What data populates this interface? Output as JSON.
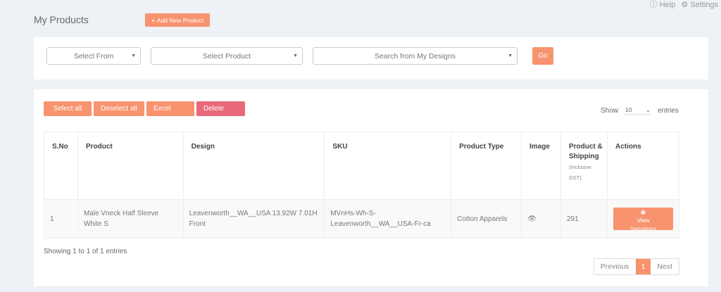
{
  "header": {
    "help": "Help",
    "settings": "Settings",
    "title": "My Products",
    "add_button": "Add New Product"
  },
  "filters": {
    "select_from": "Select From",
    "select_product": "Select Product",
    "search_designs": "Search from My Designs",
    "go": "Go"
  },
  "toolbar": {
    "select_all": "Select all",
    "deselect_all": "Deselect all",
    "excel": "Excel",
    "delete": "Delete",
    "show": "Show",
    "entries_value": "10",
    "entries": "entries"
  },
  "table": {
    "headers": [
      "S.No",
      "Product",
      "Design",
      "SKU",
      "Product Type",
      "Image",
      "Product & Shipping",
      "(Inclusive GST)",
      "Actions"
    ],
    "rows": [
      {
        "sno": "1",
        "product": "Male Vneck Half Sleeve White S",
        "design": "Leavenworth__WA__USA 13.92W 7.01H Front",
        "sku": "MVnHs-Wh-S-Leavenworth__WA__USA-Fr-ca",
        "type": "Cotton Apparels",
        "price": "291",
        "action": "View Variations"
      }
    ]
  },
  "footer": {
    "info": "Showing 1 to 1 of 1 entries",
    "previous": "Previous",
    "page": "1",
    "next": "Next"
  },
  "colors": {
    "accent": "#f7936e",
    "danger": "#e8697a"
  }
}
